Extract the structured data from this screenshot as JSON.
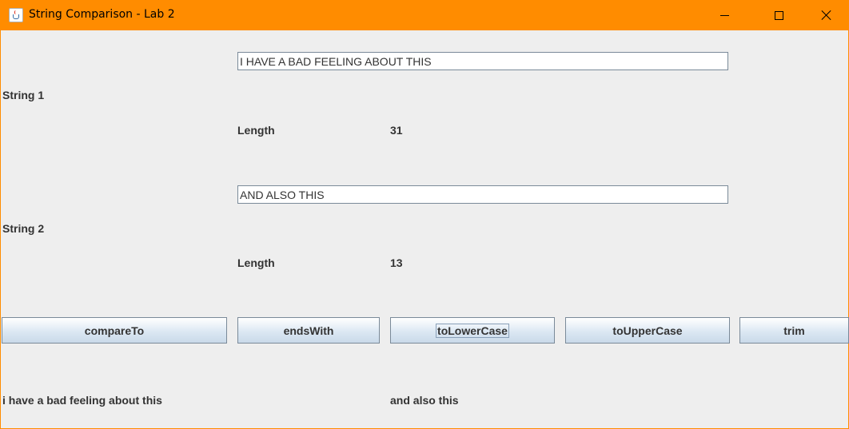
{
  "window": {
    "title": "String Comparison - Lab 2",
    "icon": "java-cup-icon",
    "accent_color": "#ff8c00"
  },
  "string1": {
    "label": "String 1",
    "value": "I HAVE A BAD FEELING ABOUT THIS",
    "length_label": "Length",
    "length_value": "31"
  },
  "string2": {
    "label": "String 2",
    "value": "AND ALSO THIS",
    "length_label": "Length",
    "length_value": "13"
  },
  "buttons": {
    "compareTo": "compareTo",
    "endsWith": "endsWith",
    "toLowerCase": "toLowerCase",
    "toUpperCase": "toUpperCase",
    "trim": "trim"
  },
  "results": {
    "result1": "i have a bad feeling about this",
    "result2": "and also this"
  }
}
